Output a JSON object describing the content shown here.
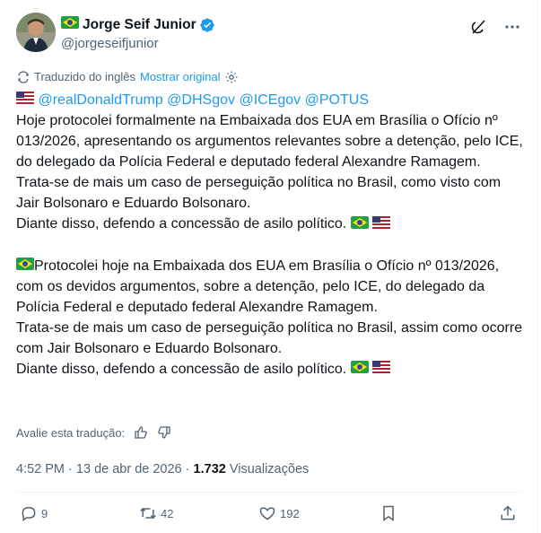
{
  "author": {
    "name": "Jorge Seif Junior",
    "handle": "@jorgeseifjunior",
    "verified": true
  },
  "translation": {
    "notice": "Traduzido do inglês",
    "show_original": "Mostrar original"
  },
  "post": {
    "mentions": [
      "@realDonaldTrump",
      "@DHSgov",
      "@ICEgov",
      "@POTUS"
    ],
    "p1": "Hoje protocolei formalmente na Embaixada dos EUA em Brasília o Ofício nº 013/2026, apresentando os argumentos relevantes sobre a detenção, pelo ICE, do delegado da Polícia Federal e deputado federal Alexandre Ramagem.",
    "p2": "Trata-se de mais um caso de perseguição política no Brasil, como visto com Jair Bolsonaro e Eduardo Bolsonaro.",
    "p3": "Diante disso, defendo a concessão de asilo político.",
    "p4": "Protocolei hoje na Embaixada dos EUA em Brasília o Ofício nº 013/2026, com os devidos argumentos, sobre a detenção, pelo ICE, do delegado da Polícia Federal e deputado federal Alexandre Ramagem.",
    "p5": "Trata-se de mais um caso de perseguição política no Brasil, assim como ocorre com Jair Bolsonaro e Eduardo Bolsonaro.",
    "p6": "Diante disso, defendo a concessão de asilo político."
  },
  "rate_translation": "Avalie esta tradução:",
  "meta": {
    "time": "4:52 PM",
    "separator": "·",
    "date": "13 de abr de 2026",
    "views_count": "1.732",
    "views_label": "Visualizações"
  },
  "stats": {
    "replies": "9",
    "reposts": "42",
    "likes": "192"
  },
  "icons": [
    "brazil-flag-icon",
    "usa-flag-icon",
    "verified-badge-icon",
    "grok-icon",
    "more-icon",
    "translate-icon",
    "gear-icon",
    "thumbs-up-icon",
    "thumbs-down-icon",
    "reply-icon",
    "repost-icon",
    "like-icon",
    "bookmark-icon",
    "share-icon"
  ],
  "colors": {
    "accent": "#1d9bf0",
    "text": "#0f1419",
    "secondary": "#536471"
  }
}
